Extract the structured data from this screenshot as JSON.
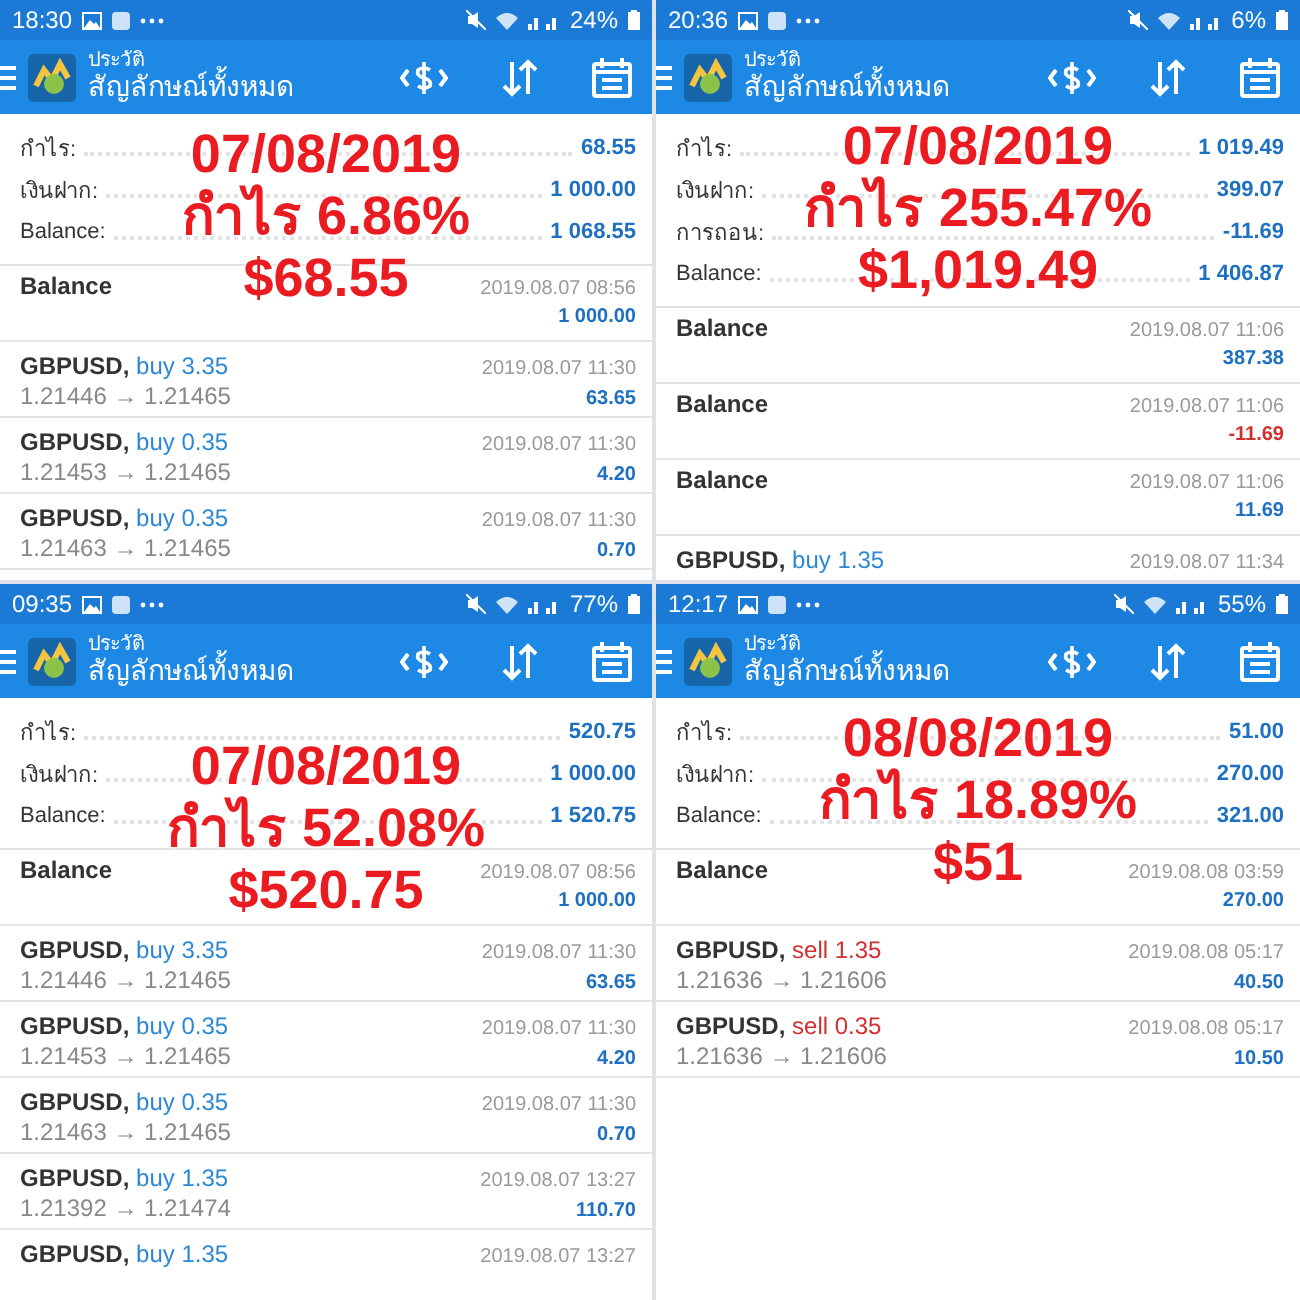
{
  "panels": [
    {
      "status_bar": {
        "time": "18:30",
        "battery": "24%"
      },
      "header": {
        "subtitle": "ประวัติ",
        "title": "สัญลักษณ์ทั้งหมด"
      },
      "summary": [
        {
          "label": "กำไร:",
          "value": "68.55"
        },
        {
          "label": "เงินฝาก:",
          "value": "1 000.00"
        },
        {
          "label": "Balance:",
          "value": "1 068.55"
        }
      ],
      "overlay": [
        "07/08/2019",
        "กำไร 6.86%",
        "$68.55"
      ],
      "records": [
        {
          "kind": "balance",
          "title": "Balance",
          "time": "2019.08.07 08:56",
          "amount": "1 000.00",
          "negative": false
        },
        {
          "kind": "deal",
          "symbol": "GBPUSD,",
          "color": "#2b88d8",
          "order": "buy 3.35",
          "prices": "1.21446 → 1.21465",
          "time": "2019.08.07 11:30",
          "amount": "63.65",
          "negative": false
        },
        {
          "kind": "deal",
          "symbol": "GBPUSD,",
          "color": "#2b88d8",
          "order": "buy 0.35",
          "prices": "1.21453 → 1.21465",
          "time": "2019.08.07 11:30",
          "amount": "4.20",
          "negative": false
        },
        {
          "kind": "deal",
          "symbol": "GBPUSD,",
          "color": "#2b88d8",
          "order": "buy 0.35",
          "prices": "1.21463 → 1.21465",
          "time": "2019.08.07 11:30",
          "amount": "0.70",
          "negative": false
        }
      ]
    },
    {
      "status_bar": {
        "time": "20:36",
        "battery": "6%"
      },
      "header": {
        "subtitle": "ประวัติ",
        "title": "สัญลักษณ์ทั้งหมด"
      },
      "summary": [
        {
          "label": "กำไร:",
          "value": "1 019.49"
        },
        {
          "label": "เงินฝาก:",
          "value": "399.07"
        },
        {
          "label": "การถอน:",
          "value": "-11.69"
        },
        {
          "label": "Balance:",
          "value": "1 406.87"
        }
      ],
      "overlay": [
        "07/08/2019",
        "กำไร 255.47%",
        "$1,019.49"
      ],
      "records": [
        {
          "kind": "balance",
          "title": "Balance",
          "time": "2019.08.07 11:06",
          "amount": "387.38",
          "negative": false
        },
        {
          "kind": "balance",
          "title": "Balance",
          "time": "2019.08.07 11:06",
          "amount": "-11.69",
          "negative": true
        },
        {
          "kind": "balance",
          "title": "Balance",
          "time": "2019.08.07 11:06",
          "amount": "11.69",
          "negative": false
        },
        {
          "kind": "deal",
          "symbol": "GBPUSD,",
          "color": "#2b88d8",
          "order": "buy 1.35",
          "time": "2019.08.07 11:34"
        }
      ]
    },
    {
      "status_bar": {
        "time": "09:35",
        "battery": "77%"
      },
      "header": {
        "subtitle": "ประวัติ",
        "title": "สัญลักษณ์ทั้งหมด"
      },
      "summary": [
        {
          "label": "กำไร:",
          "value": "520.75"
        },
        {
          "label": "เงินฝาก:",
          "value": "1 000.00"
        },
        {
          "label": "Balance:",
          "value": "1 520.75"
        }
      ],
      "overlay": [
        "07/08/2019",
        "กำไร 52.08%",
        "$520.75"
      ],
      "records": [
        {
          "kind": "balance",
          "title": "Balance",
          "time": "2019.08.07 08:56",
          "amount": "1 000.00",
          "negative": false
        },
        {
          "kind": "deal",
          "symbol": "GBPUSD,",
          "color": "#2b88d8",
          "order": "buy 3.35",
          "prices": "1.21446 → 1.21465",
          "time": "2019.08.07 11:30",
          "amount": "63.65",
          "negative": false
        },
        {
          "kind": "deal",
          "symbol": "GBPUSD,",
          "color": "#2b88d8",
          "order": "buy 0.35",
          "prices": "1.21453 → 1.21465",
          "time": "2019.08.07 11:30",
          "amount": "4.20",
          "negative": false
        },
        {
          "kind": "deal",
          "symbol": "GBPUSD,",
          "color": "#2b88d8",
          "order": "buy 0.35",
          "prices": "1.21463 → 1.21465",
          "time": "2019.08.07 11:30",
          "amount": "0.70",
          "negative": false
        },
        {
          "kind": "deal",
          "symbol": "GBPUSD,",
          "color": "#2b88d8",
          "order": "buy 1.35",
          "prices": "1.21392 → 1.21474",
          "time": "2019.08.07 13:27",
          "amount": "110.70",
          "negative": false
        },
        {
          "kind": "deal",
          "symbol": "GBPUSD,",
          "color": "#2b88d8",
          "order": "buy 1.35",
          "time": "2019.08.07 13:27"
        }
      ]
    },
    {
      "status_bar": {
        "time": "12:17",
        "battery": "55%"
      },
      "header": {
        "subtitle": "ประวัติ",
        "title": "สัญลักษณ์ทั้งหมด"
      },
      "summary": [
        {
          "label": "กำไร:",
          "value": "51.00"
        },
        {
          "label": "เงินฝาก:",
          "value": "270.00"
        },
        {
          "label": "Balance:",
          "value": "321.00"
        }
      ],
      "overlay": [
        "08/08/2019",
        "กำไร 18.89%",
        "$51"
      ],
      "records": [
        {
          "kind": "balance",
          "title": "Balance",
          "time": "2019.08.08 03:59",
          "amount": "270.00",
          "negative": false
        },
        {
          "kind": "deal",
          "symbol": "GBPUSD,",
          "color": "#d32f2f",
          "order": "sell 1.35",
          "prices": "1.21636 → 1.21606",
          "time": "2019.08.08 05:17",
          "amount": "40.50",
          "negative": false
        },
        {
          "kind": "deal",
          "symbol": "GBPUSD,",
          "color": "#d32f2f",
          "order": "sell 0.35",
          "prices": "1.21636 → 1.21606",
          "time": "2019.08.08 05:17",
          "amount": "10.50",
          "negative": false
        }
      ]
    }
  ]
}
